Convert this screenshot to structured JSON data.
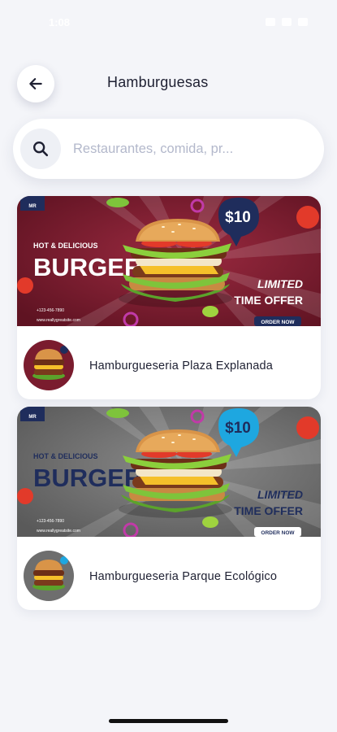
{
  "status_bar": {
    "time": "1:08"
  },
  "header": {
    "title": "Hamburguesas",
    "back_icon": "arrow-left-icon"
  },
  "search": {
    "placeholder": "Restaurantes, comida, pr...",
    "value": "",
    "icon": "search-icon"
  },
  "restaurants": [
    {
      "name": "Hamburgueseria Plaza Explanada",
      "banner": {
        "brand": "MR",
        "tagline": "HOT & DELICIOUS",
        "headline": "BURGER",
        "price": "$10",
        "offer_line1": "LIMITED",
        "offer_line2": "TIME OFFER",
        "cta": "ORDER NOW",
        "phone": "+123-456-7890",
        "website": "www.reallygreatsite.com",
        "background_color": "#7a1c2e",
        "price_bubble_color": "#1f2d5c"
      }
    },
    {
      "name": "Hamburgueseria Parque Ecológico",
      "banner": {
        "brand": "MR",
        "tagline": "HOT & DELICIOUS",
        "headline": "BURGER",
        "price": "$10",
        "offer_line1": "LIMITED",
        "offer_line2": "TIME OFFER",
        "cta": "ORDER NOW",
        "phone": "+123-456-7890",
        "website": "www.reallygreatsite.com",
        "background_color": "#6e6e6e",
        "price_bubble_color": "#1ea7e0"
      }
    }
  ]
}
